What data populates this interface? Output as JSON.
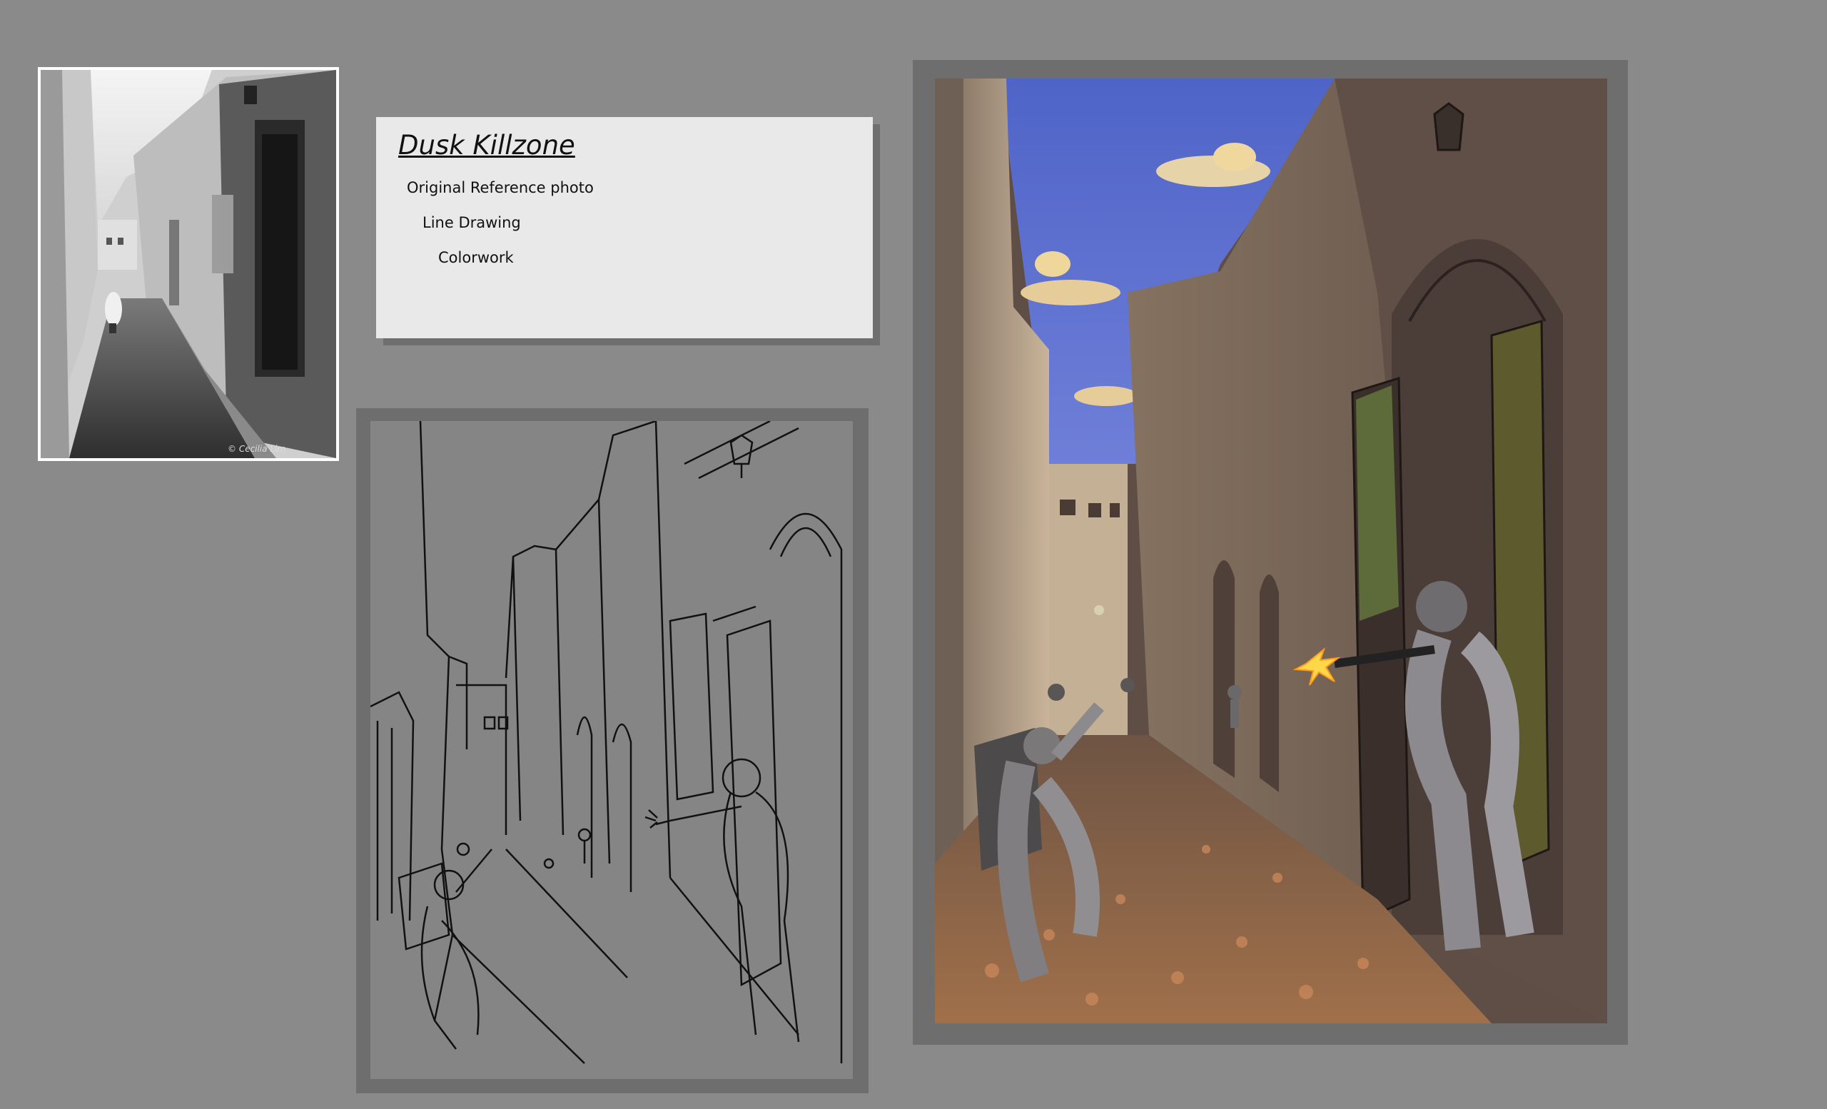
{
  "info": {
    "title": "Dusk Killzone",
    "lines": [
      "Original Reference photo",
      "Line Drawing",
      "Colorwork"
    ]
  },
  "reference_photo": {
    "signature": "© Cecilia Lim"
  },
  "colors": {
    "background": "#8a8a8a",
    "frame": "#6e6e6e",
    "card": "#e9e9e9",
    "sky": "#5a6fd0",
    "wall": "#6a5a52",
    "ground": "#8a5f3e"
  }
}
